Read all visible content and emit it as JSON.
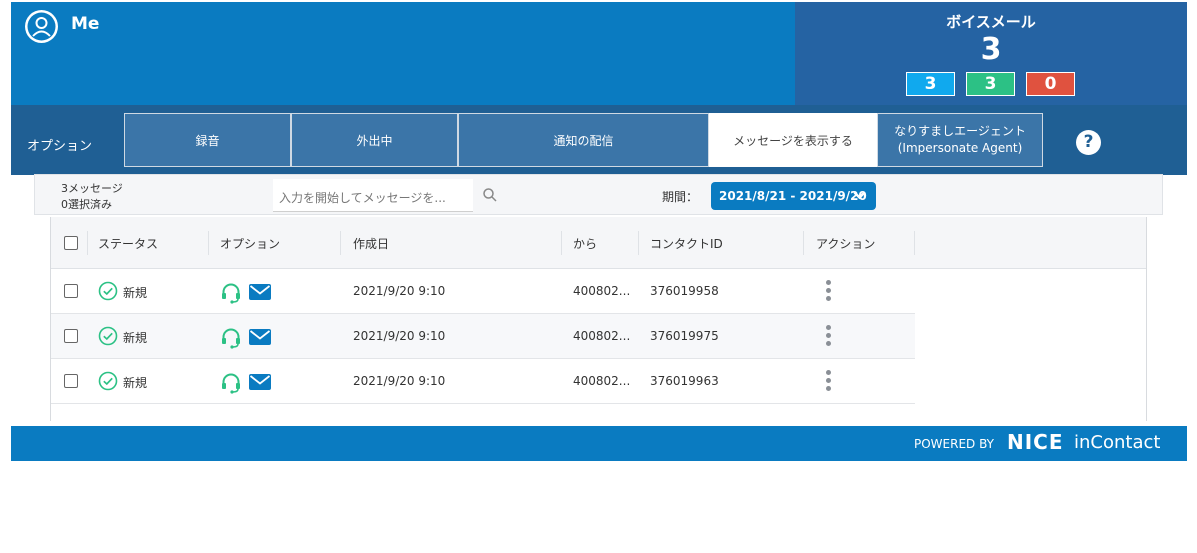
{
  "header": {
    "user_name": "Me",
    "voicemail": {
      "title": "ボイスメール",
      "total": "3",
      "badges": [
        {
          "value": "3",
          "color": "#10a9ee"
        },
        {
          "value": "3",
          "color": "#2cc185"
        },
        {
          "value": "0",
          "color": "#e0523f"
        }
      ]
    }
  },
  "options": {
    "label": "オプション",
    "tabs": [
      {
        "label": "録音"
      },
      {
        "label": "外出中"
      },
      {
        "label": "通知の配信"
      },
      {
        "label": "メッセージを表示する",
        "active": true
      },
      {
        "label": "なりすましエージェント",
        "sub": "(Impersonate Agent)"
      }
    ],
    "help_icon": "help-circle-icon"
  },
  "toolbar": {
    "message_count": "3メッセージ",
    "selected_count": "0選択済み",
    "search_placeholder": "入力を開始してメッセージを...",
    "period_label": "期間：",
    "period_value": "2021/8/21 - 2021/9/20"
  },
  "table": {
    "columns": [
      "ステータス",
      "オプション",
      "作成日",
      "から",
      "コンタクトID",
      "アクション"
    ],
    "rows": [
      {
        "status": "新規",
        "created": "2021/9/20 9:10",
        "from": "400802...",
        "contact_id": "376019958"
      },
      {
        "status": "新規",
        "created": "2021/9/20 9:10",
        "from": "400802...",
        "contact_id": "376019975"
      },
      {
        "status": "新規",
        "created": "2021/9/20 9:10",
        "from": "400802...",
        "contact_id": "376019963"
      }
    ]
  },
  "footer": {
    "powered_by": "POWERED BY",
    "brand1": "NICE",
    "brand2": "inContact"
  },
  "colors": {
    "header_blue": "#0a7bc1",
    "voicemail_panel": "#2563a3",
    "options_bar": "#1f5f94",
    "status_green": "#2cc185"
  }
}
